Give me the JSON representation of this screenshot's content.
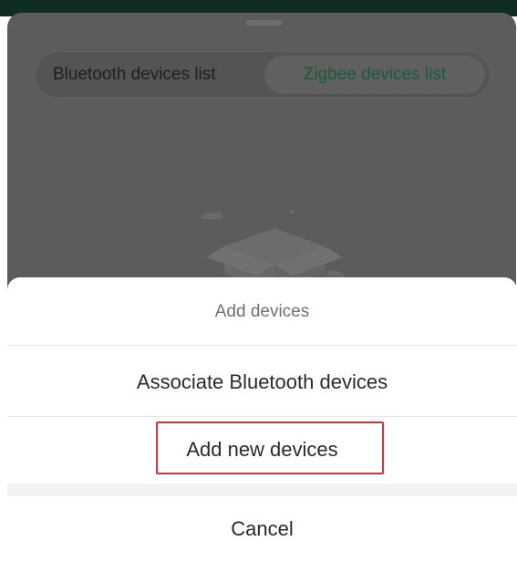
{
  "background_screen": {
    "tabs": [
      {
        "label": "Bluetooth devices list",
        "active": false
      },
      {
        "label": "Zigbee devices list",
        "active": true
      }
    ],
    "accent_color": "#1c5a3c"
  },
  "sheet": {
    "title": "Add devices",
    "options": [
      {
        "label": "Associate Bluetooth devices"
      },
      {
        "label": "Add new devices",
        "highlighted": true
      }
    ],
    "cancel_label": "Cancel",
    "highlight_color": "#d0343c"
  }
}
